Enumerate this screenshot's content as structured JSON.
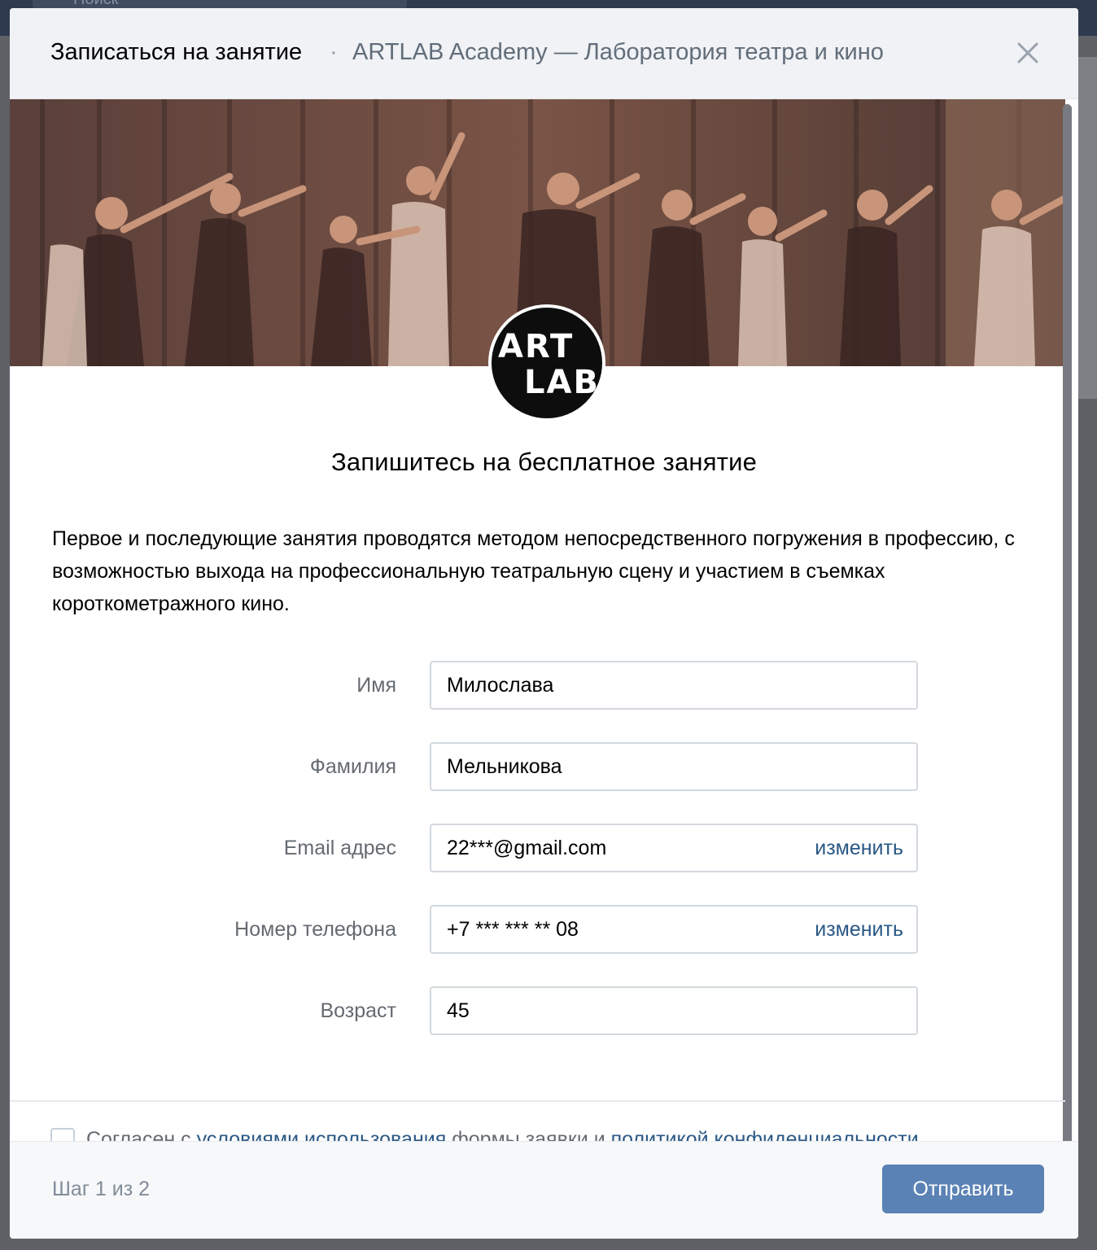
{
  "background": {
    "search_placeholder": "Поиск"
  },
  "header": {
    "title": "Записаться на занятие",
    "separator": "·",
    "community": "ARTLAB Academy — Лаборатория театра и кино"
  },
  "logo": {
    "line1": "ART",
    "line2": "LAB"
  },
  "content": {
    "title": "Запишитесь на бесплатное занятие",
    "description": "Первое и последующие занятия проводятся методом непосредственного погружения в профессию, с возможностью выхода на профессиональную театральную сцену и участием в съемках короткометражного кино."
  },
  "form": {
    "fields": [
      {
        "label": "Имя",
        "value": "Милослава"
      },
      {
        "label": "Фамилия",
        "value": "Мельникова"
      },
      {
        "label": "Email адрес",
        "value": "22***@gmail.com",
        "action": "изменить"
      },
      {
        "label": "Номер телефона",
        "value": "+7 *** *** ** 08",
        "action": "изменить"
      },
      {
        "label": "Возраст",
        "value": "45"
      }
    ]
  },
  "consent": {
    "prefix": "Согласен с ",
    "link1": "условиями использования",
    "middle": " формы заявки и ",
    "link2": "политикой конфиденциальности"
  },
  "footer": {
    "step": "Шаг 1 из 2",
    "submit": "Отправить"
  },
  "colors": {
    "accent": "#5b82b5",
    "link": "#2a5885",
    "header_bg": "#f0f2f5"
  }
}
